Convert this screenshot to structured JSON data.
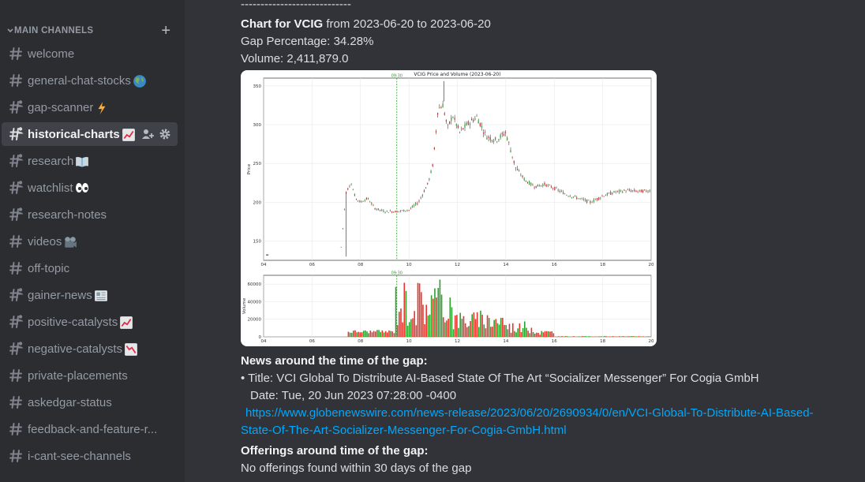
{
  "sidebar": {
    "category": {
      "label": "MAIN CHANNELS",
      "add_icon": "plus-icon"
    },
    "channels": [
      {
        "name": "welcome",
        "emoji": ""
      },
      {
        "name": "general-chat-stocks",
        "emoji": "globe"
      },
      {
        "name": "gap-scanner",
        "emoji": "lightning"
      },
      {
        "name": "historical-charts",
        "emoji": "chart-up",
        "active": true
      },
      {
        "name": "research",
        "emoji": "book"
      },
      {
        "name": "watchlist",
        "emoji": "eyes"
      },
      {
        "name": "research-notes",
        "emoji": ""
      },
      {
        "name": "videos",
        "emoji": "camera"
      },
      {
        "name": "off-topic",
        "emoji": ""
      },
      {
        "name": "gainer-news",
        "emoji": "newspaper"
      },
      {
        "name": "positive-catalysts",
        "emoji": "chart-up"
      },
      {
        "name": "negative-catalysts",
        "emoji": "chart-down"
      },
      {
        "name": "private-placements",
        "emoji": ""
      },
      {
        "name": "askedgar-status",
        "emoji": ""
      },
      {
        "name": "feedback-and-feature-r...",
        "emoji": ""
      },
      {
        "name": "i-cant-see-channels",
        "emoji": ""
      }
    ]
  },
  "message": {
    "divider": "----------------------------",
    "chart_title_bold": "Chart for VCIG",
    "chart_title_rest": " from 2023-06-20 to 2023-06-20",
    "gap": "Gap Percentage: 34.28%",
    "volume": "Volume: 2,411,879.0",
    "news_heading": "News around the time of the gap:",
    "news_title": "• Title: VCI Global To Distribute AI-Based State Of The Art “Socializer Messenger” For Cogia GmbH",
    "news_date": "Date: Tue, 20 Jun 2023 07:28:00 -0400",
    "news_link_1": "https://www.globenewswire.com/news-release/2023/06/20/2690934/0/en/VCI-Global-To-Distribute-AI-Based-",
    "news_link_2": "State-Of-The-Art-Socializer-Messenger-For-Cogia-GmbH.html",
    "offerings_heading": "Offerings around time of the gap:",
    "offerings_text": "No offerings found within 30 days of the gap"
  },
  "chart_data": {
    "type": "line",
    "title": "VCIG Price and Volume (2023-06-20)",
    "marker_label": "09:30",
    "marker_x": 9.5,
    "xlim": [
      4,
      20
    ],
    "x_ticks": [
      "04",
      "06",
      "08",
      "10",
      "12",
      "14",
      "16",
      "18",
      "20"
    ],
    "price": {
      "ylabel": "Price",
      "ylim": [
        125,
        360
      ],
      "y_ticks": [
        150,
        200,
        250,
        300,
        350
      ],
      "x": [
        4.1,
        7.2,
        7.4,
        7.6,
        7.8,
        8.0,
        8.3,
        8.6,
        9.0,
        9.5,
        10.0,
        10.4,
        10.8,
        11.0,
        11.2,
        11.4,
        11.6,
        11.8,
        12.1,
        12.4,
        12.8,
        13.2,
        13.6,
        14.0,
        14.4,
        14.8,
        15.2,
        15.6,
        16.0,
        16.5,
        17.0,
        17.5,
        18.0,
        18.5,
        19.0,
        19.5,
        20.0
      ],
      "y": [
        130,
        142,
        212,
        225,
        205,
        200,
        205,
        192,
        188,
        188,
        190,
        200,
        225,
        250,
        320,
        325,
        295,
        312,
        290,
        300,
        310,
        285,
        280,
        290,
        245,
        228,
        220,
        223,
        218,
        210,
        205,
        200,
        208,
        213,
        215,
        214,
        215
      ]
    },
    "volume": {
      "ylabel": "Volume",
      "ylim": [
        0,
        70000
      ],
      "y_ticks": [
        0,
        20000,
        40000,
        60000
      ]
    }
  }
}
